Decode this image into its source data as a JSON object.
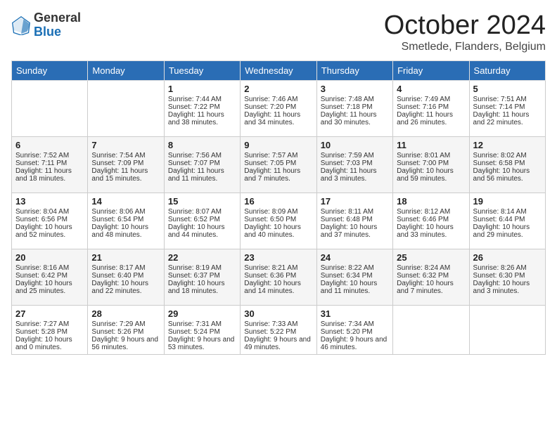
{
  "header": {
    "logo_general": "General",
    "logo_blue": "Blue",
    "month_title": "October 2024",
    "subtitle": "Smetlede, Flanders, Belgium"
  },
  "days_of_week": [
    "Sunday",
    "Monday",
    "Tuesday",
    "Wednesday",
    "Thursday",
    "Friday",
    "Saturday"
  ],
  "weeks": [
    [
      {
        "day": "",
        "sunrise": "",
        "sunset": "",
        "daylight": ""
      },
      {
        "day": "",
        "sunrise": "",
        "sunset": "",
        "daylight": ""
      },
      {
        "day": "1",
        "sunrise": "Sunrise: 7:44 AM",
        "sunset": "Sunset: 7:22 PM",
        "daylight": "Daylight: 11 hours and 38 minutes."
      },
      {
        "day": "2",
        "sunrise": "Sunrise: 7:46 AM",
        "sunset": "Sunset: 7:20 PM",
        "daylight": "Daylight: 11 hours and 34 minutes."
      },
      {
        "day": "3",
        "sunrise": "Sunrise: 7:48 AM",
        "sunset": "Sunset: 7:18 PM",
        "daylight": "Daylight: 11 hours and 30 minutes."
      },
      {
        "day": "4",
        "sunrise": "Sunrise: 7:49 AM",
        "sunset": "Sunset: 7:16 PM",
        "daylight": "Daylight: 11 hours and 26 minutes."
      },
      {
        "day": "5",
        "sunrise": "Sunrise: 7:51 AM",
        "sunset": "Sunset: 7:14 PM",
        "daylight": "Daylight: 11 hours and 22 minutes."
      }
    ],
    [
      {
        "day": "6",
        "sunrise": "Sunrise: 7:52 AM",
        "sunset": "Sunset: 7:11 PM",
        "daylight": "Daylight: 11 hours and 18 minutes."
      },
      {
        "day": "7",
        "sunrise": "Sunrise: 7:54 AM",
        "sunset": "Sunset: 7:09 PM",
        "daylight": "Daylight: 11 hours and 15 minutes."
      },
      {
        "day": "8",
        "sunrise": "Sunrise: 7:56 AM",
        "sunset": "Sunset: 7:07 PM",
        "daylight": "Daylight: 11 hours and 11 minutes."
      },
      {
        "day": "9",
        "sunrise": "Sunrise: 7:57 AM",
        "sunset": "Sunset: 7:05 PM",
        "daylight": "Daylight: 11 hours and 7 minutes."
      },
      {
        "day": "10",
        "sunrise": "Sunrise: 7:59 AM",
        "sunset": "Sunset: 7:03 PM",
        "daylight": "Daylight: 11 hours and 3 minutes."
      },
      {
        "day": "11",
        "sunrise": "Sunrise: 8:01 AM",
        "sunset": "Sunset: 7:00 PM",
        "daylight": "Daylight: 10 hours and 59 minutes."
      },
      {
        "day": "12",
        "sunrise": "Sunrise: 8:02 AM",
        "sunset": "Sunset: 6:58 PM",
        "daylight": "Daylight: 10 hours and 56 minutes."
      }
    ],
    [
      {
        "day": "13",
        "sunrise": "Sunrise: 8:04 AM",
        "sunset": "Sunset: 6:56 PM",
        "daylight": "Daylight: 10 hours and 52 minutes."
      },
      {
        "day": "14",
        "sunrise": "Sunrise: 8:06 AM",
        "sunset": "Sunset: 6:54 PM",
        "daylight": "Daylight: 10 hours and 48 minutes."
      },
      {
        "day": "15",
        "sunrise": "Sunrise: 8:07 AM",
        "sunset": "Sunset: 6:52 PM",
        "daylight": "Daylight: 10 hours and 44 minutes."
      },
      {
        "day": "16",
        "sunrise": "Sunrise: 8:09 AM",
        "sunset": "Sunset: 6:50 PM",
        "daylight": "Daylight: 10 hours and 40 minutes."
      },
      {
        "day": "17",
        "sunrise": "Sunrise: 8:11 AM",
        "sunset": "Sunset: 6:48 PM",
        "daylight": "Daylight: 10 hours and 37 minutes."
      },
      {
        "day": "18",
        "sunrise": "Sunrise: 8:12 AM",
        "sunset": "Sunset: 6:46 PM",
        "daylight": "Daylight: 10 hours and 33 minutes."
      },
      {
        "day": "19",
        "sunrise": "Sunrise: 8:14 AM",
        "sunset": "Sunset: 6:44 PM",
        "daylight": "Daylight: 10 hours and 29 minutes."
      }
    ],
    [
      {
        "day": "20",
        "sunrise": "Sunrise: 8:16 AM",
        "sunset": "Sunset: 6:42 PM",
        "daylight": "Daylight: 10 hours and 25 minutes."
      },
      {
        "day": "21",
        "sunrise": "Sunrise: 8:17 AM",
        "sunset": "Sunset: 6:40 PM",
        "daylight": "Daylight: 10 hours and 22 minutes."
      },
      {
        "day": "22",
        "sunrise": "Sunrise: 8:19 AM",
        "sunset": "Sunset: 6:37 PM",
        "daylight": "Daylight: 10 hours and 18 minutes."
      },
      {
        "day": "23",
        "sunrise": "Sunrise: 8:21 AM",
        "sunset": "Sunset: 6:36 PM",
        "daylight": "Daylight: 10 hours and 14 minutes."
      },
      {
        "day": "24",
        "sunrise": "Sunrise: 8:22 AM",
        "sunset": "Sunset: 6:34 PM",
        "daylight": "Daylight: 10 hours and 11 minutes."
      },
      {
        "day": "25",
        "sunrise": "Sunrise: 8:24 AM",
        "sunset": "Sunset: 6:32 PM",
        "daylight": "Daylight: 10 hours and 7 minutes."
      },
      {
        "day": "26",
        "sunrise": "Sunrise: 8:26 AM",
        "sunset": "Sunset: 6:30 PM",
        "daylight": "Daylight: 10 hours and 3 minutes."
      }
    ],
    [
      {
        "day": "27",
        "sunrise": "Sunrise: 7:27 AM",
        "sunset": "Sunset: 5:28 PM",
        "daylight": "Daylight: 10 hours and 0 minutes."
      },
      {
        "day": "28",
        "sunrise": "Sunrise: 7:29 AM",
        "sunset": "Sunset: 5:26 PM",
        "daylight": "Daylight: 9 hours and 56 minutes."
      },
      {
        "day": "29",
        "sunrise": "Sunrise: 7:31 AM",
        "sunset": "Sunset: 5:24 PM",
        "daylight": "Daylight: 9 hours and 53 minutes."
      },
      {
        "day": "30",
        "sunrise": "Sunrise: 7:33 AM",
        "sunset": "Sunset: 5:22 PM",
        "daylight": "Daylight: 9 hours and 49 minutes."
      },
      {
        "day": "31",
        "sunrise": "Sunrise: 7:34 AM",
        "sunset": "Sunset: 5:20 PM",
        "daylight": "Daylight: 9 hours and 46 minutes."
      },
      {
        "day": "",
        "sunrise": "",
        "sunset": "",
        "daylight": ""
      },
      {
        "day": "",
        "sunrise": "",
        "sunset": "",
        "daylight": ""
      }
    ]
  ]
}
